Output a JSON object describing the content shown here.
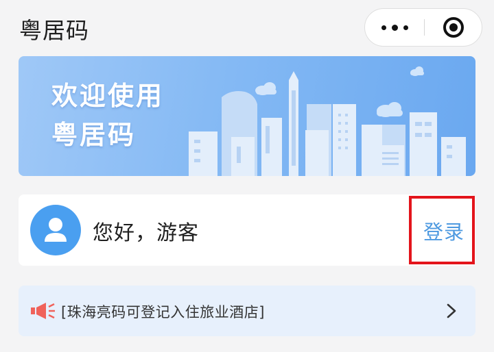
{
  "header": {
    "title": "粤居码",
    "more_icon": "more-dots-icon",
    "close_icon": "target-circle-icon"
  },
  "banner": {
    "line1": "欢迎使用",
    "line2": "粤居码"
  },
  "user": {
    "greeting": "您好，游客",
    "login_label": "登录",
    "avatar_icon": "person-icon"
  },
  "notice": {
    "text": "[珠海亮码可登记入住旅业酒店]",
    "icon": "speaker-icon",
    "arrow_icon": "chevron-right-icon"
  },
  "colors": {
    "accent": "#4d99e0",
    "avatar": "#4a9ff0",
    "highlight": "#e3141b",
    "notice_bg": "#e7f0fc",
    "speaker": "#f0625a"
  }
}
